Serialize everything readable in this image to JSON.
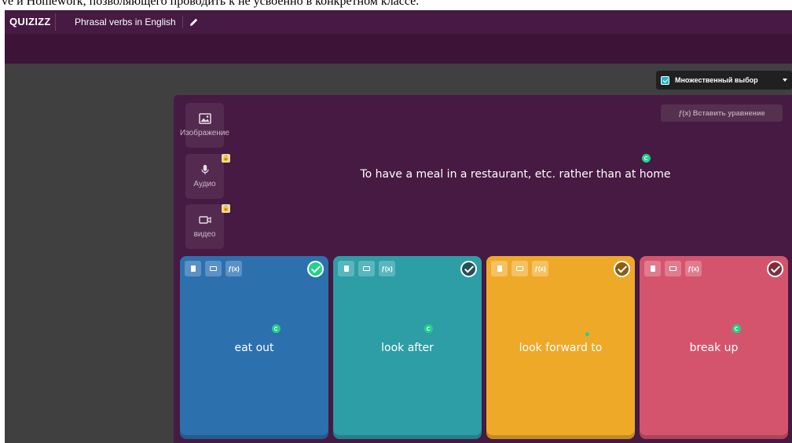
{
  "caption": "ve и Homework, позволяющего проводить  к не усвоенно в конкретном классе.",
  "app": {
    "logo": "QUIZIZZ",
    "quiz_title": "Phrasal verbs in English"
  },
  "question_type": {
    "selected": "Множественный выбор",
    "icon": "checkbox-icon"
  },
  "media": {
    "image_label": "Изображение",
    "audio_label": "Аудио",
    "video_label": "видео"
  },
  "equation_button": "ƒ(x) Вставить уравнение",
  "question": {
    "text": "To have a meal in a restaurant, etc. rather than at home"
  },
  "answers": [
    {
      "text": "eat out",
      "color": "#2d70ae",
      "tool_color": "#5b91c4",
      "correct_fill": "#23d18b",
      "correct": true
    },
    {
      "text": "look after",
      "color": "#2d9da6",
      "tool_color": "#5ab6bd",
      "correct_fill": "#225158",
      "correct": false
    },
    {
      "text": "look forward to",
      "color": "#efa929",
      "tool_color": "#f4c163",
      "correct_fill": "#8a5d16",
      "correct": false
    },
    {
      "text": "break up",
      "color": "#d5546d",
      "tool_color": "#e07c8f",
      "correct_fill": "#7d2f3d",
      "correct": false
    }
  ],
  "tool_labels": {
    "equation": "ƒ(x)"
  },
  "colors": {
    "topbar": "#461a42",
    "editor_bg": "#461a42",
    "accent_green": "#23d18b"
  }
}
